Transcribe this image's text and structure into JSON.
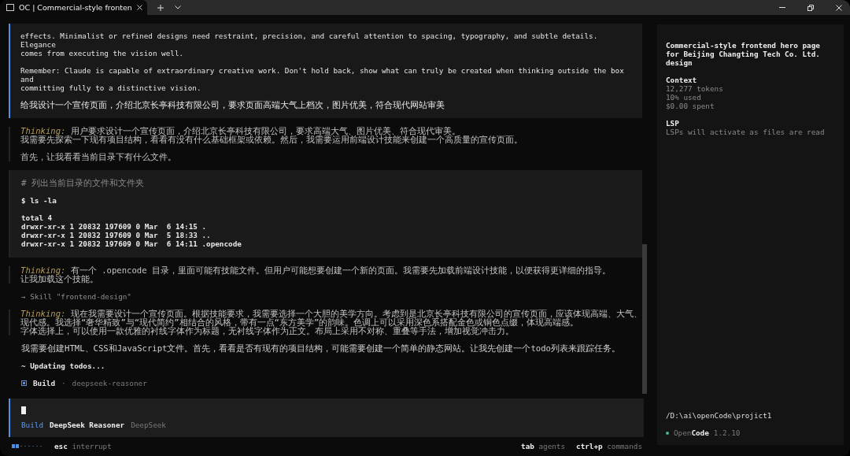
{
  "window": {
    "tab_title": "OC | Commercial-style fronten"
  },
  "conversation": [
    {
      "kind": "user",
      "paragraphs": [
        "effects. Minimalist or refined designs need restraint, precision, and careful attention to spacing, typography, and subtle details. Elegance\ncomes from executing the vision well.",
        "Remember: Claude is capable of extraordinary creative work. Don't hold back, show what can truly be created when thinking outside the box and\ncommitting fully to a distinctive vision.",
        "给我设计一个宣传页面，介绍北京长亭科技有限公司，要求页面高端大气上档次，图片优美，符合现代网站审美"
      ]
    },
    {
      "kind": "thinking",
      "label": "Thinking:",
      "paragraphs": [
        [
          "用户要求设计一个宣传页面，介绍北京长亭科技有限公司，要求高端大气、图片优美、符合现代审美。",
          "我需要先探索一下现有项目结构，看看有没有什么基础框架或依赖。然后，我需要运用前端设计技能来创建一个高质量的宣传页面。"
        ],
        [
          "首先，让我看看当前目录下有什么文件。"
        ]
      ]
    },
    {
      "kind": "tool",
      "comment": "# 列出当前目录的文件和文件夹",
      "command": "$ ls -la",
      "output": "total 4\ndrwxr-xr-x 1 20832 197609 0 Mar  6 14:15 .\ndrwxr-xr-x 1 20832 197609 0 Mar  5 18:33 ..\ndrwxr-xr-x 1 20832 197609 0 Mar  6 14:11 .opencode"
    },
    {
      "kind": "thinking",
      "label": "Thinking:",
      "paragraphs": [
        [
          "有一个 .opencode 目录，里面可能有技能文件。但用户可能想要创建一个新的页面。我需要先加载前端设计技能，以便获得更详细的指导。",
          "让我加载这个技能。"
        ]
      ]
    },
    {
      "kind": "skill",
      "text": "→ Skill \"frontend-design\""
    },
    {
      "kind": "thinking",
      "label": "Thinking:",
      "paragraphs": [
        [
          "现在我需要设计一个宣传页面。根据技能要求，我需要选择一个大胆的美学方向。考虑到是北京长亭科技有限公司的宣传页面，应该体现高端、大气、现代感。我选择“奢华精致”与“现代简约”相结合的风格，带有一点“东方美学”的韵味。色调上可以采用深色系搭配金色或铜色点缀，体现高端感。",
          "字体选择上，可以使用一款优雅的衬线字体作为标题，无衬线字体作为正文。布局上采用不对称、重叠等手法，增加视觉冲击力。"
        ]
      ]
    },
    {
      "kind": "plain",
      "text": "我需要创建HTML、CSS和JavaScript文件。首先，看看是否有现有的项目结构，可能需要创建一个简单的静态网站。让我先创建一个todo列表来跟踪任务。"
    },
    {
      "kind": "status",
      "text": "~ Updating todos..."
    },
    {
      "kind": "agent",
      "agent": "Build",
      "separator": "·",
      "model": "deepseek-reasoner"
    }
  ],
  "prompt": {
    "agent": "Build",
    "model": "DeepSeek Reasoner",
    "provider": "DeepSeek"
  },
  "footer": {
    "left": [
      {
        "key": "esc",
        "label": "interrupt"
      }
    ],
    "right": [
      {
        "key": "tab",
        "label": "agents"
      },
      {
        "key": "ctrl+p",
        "label": "commands"
      }
    ]
  },
  "sidebar": {
    "title": "Commercial-style frontend hero page for Beijing Changting Tech Co. Ltd. design",
    "sections": [
      {
        "heading": "Context",
        "lines": [
          "12,277 tokens",
          "10% used",
          "$0.00 spent"
        ]
      },
      {
        "heading": "LSP",
        "lines": [
          "LSPs will activate as files are read"
        ]
      }
    ],
    "path": "/D:\\ai\\openCode\\projict1",
    "app_light": "Open",
    "app_bold": "Code",
    "version": "1.2.10"
  }
}
